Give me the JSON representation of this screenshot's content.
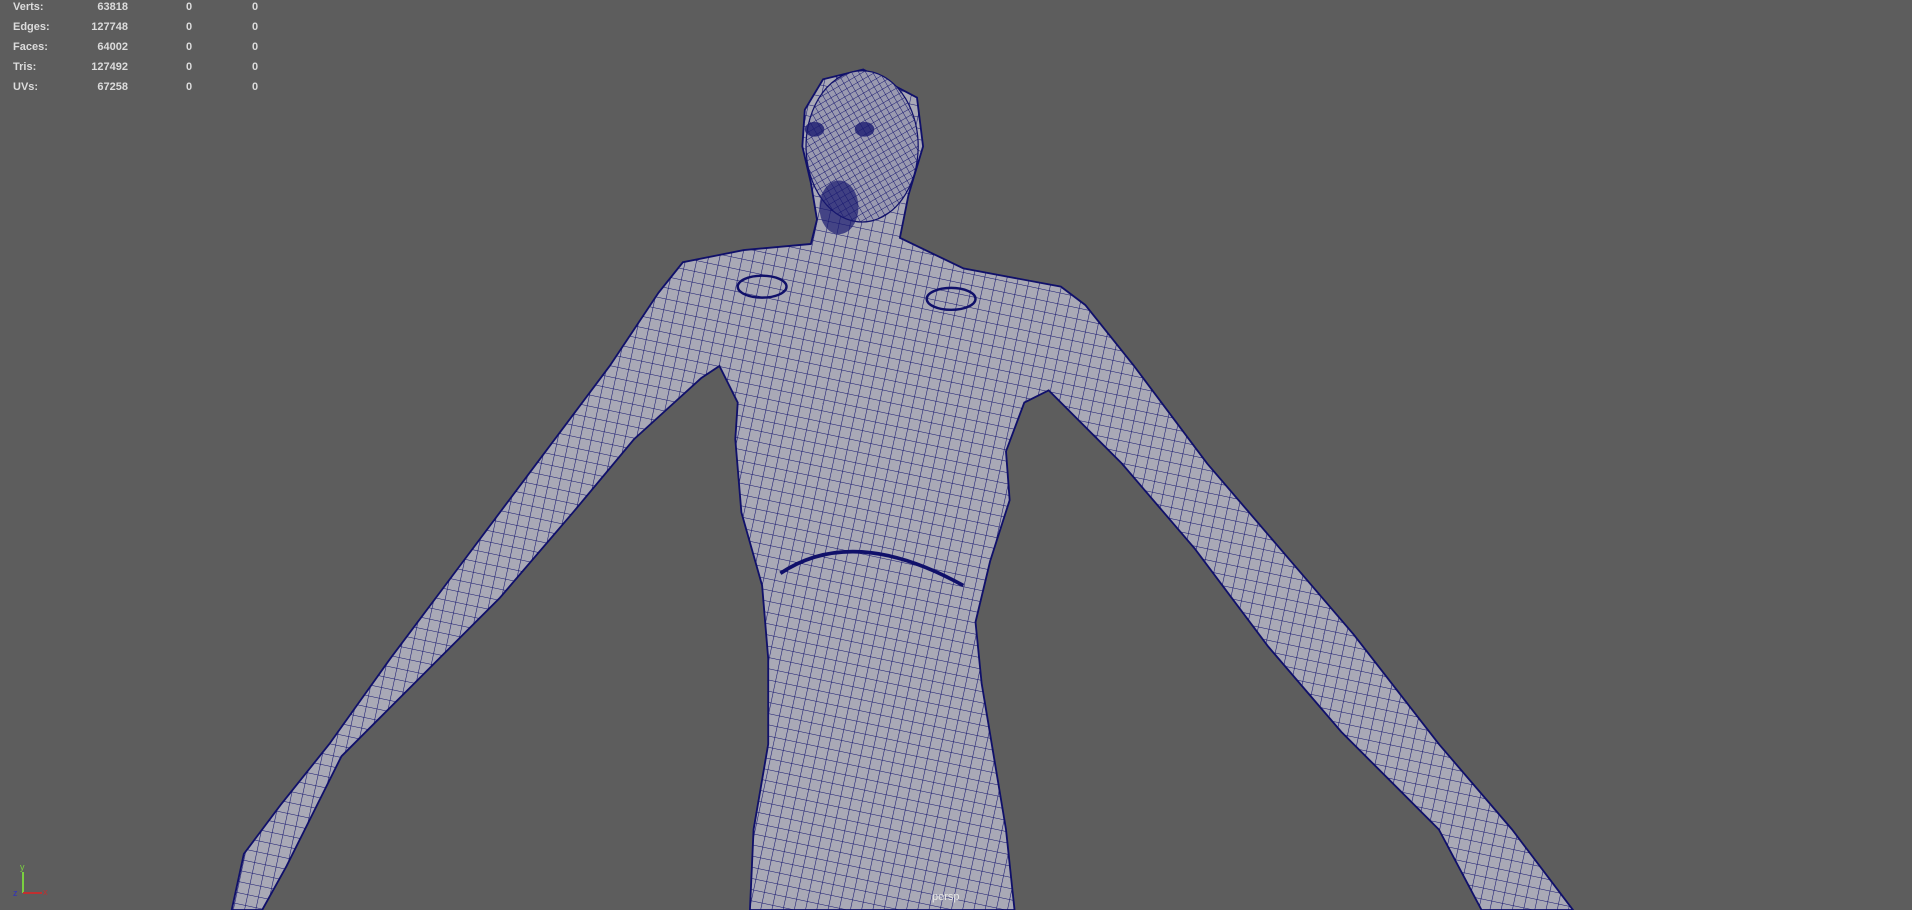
{
  "hud": {
    "rows": [
      {
        "label": "Verts:",
        "values": [
          "63818",
          "0",
          "0"
        ]
      },
      {
        "label": "Edges:",
        "values": [
          "127748",
          "0",
          "0"
        ]
      },
      {
        "label": "Faces:",
        "values": [
          "64002",
          "0",
          "0"
        ]
      },
      {
        "label": "Tris:",
        "values": [
          "127492",
          "0",
          "0"
        ]
      },
      {
        "label": "UVs:",
        "values": [
          "67258",
          "0",
          "0"
        ]
      }
    ]
  },
  "viewport": {
    "camera_label": "persp",
    "axis_labels": {
      "y": "y",
      "z": "z",
      "x": "x"
    },
    "colors": {
      "background": "#5d5d5d",
      "mesh_fill": "#a9a9b6",
      "wire": "#10106a"
    }
  }
}
